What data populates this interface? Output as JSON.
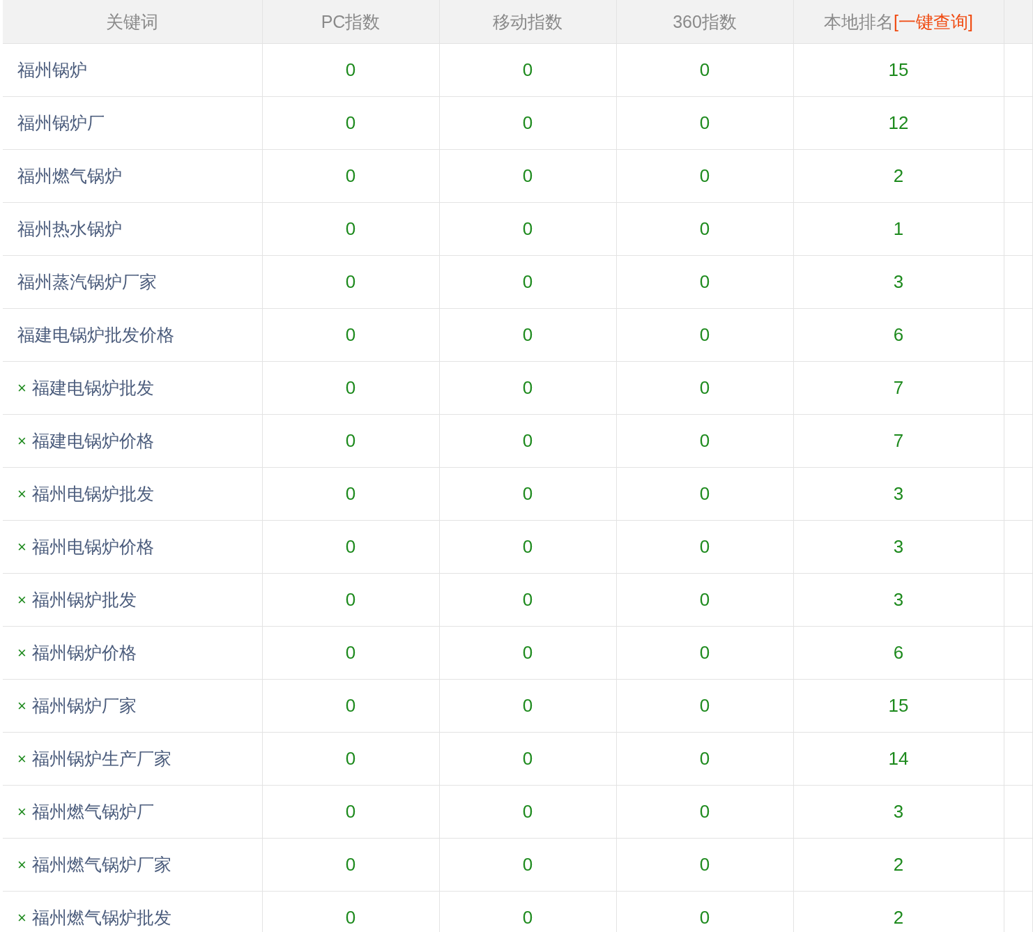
{
  "table": {
    "columns": [
      {
        "label": "关键词"
      },
      {
        "label": "PC指数"
      },
      {
        "label": "移动指数"
      },
      {
        "label": "360指数"
      },
      {
        "label": "本地排名",
        "link": "[一键查询]"
      }
    ],
    "rows": [
      {
        "prefix": null,
        "keyword": "福州锅炉",
        "pc": "0",
        "mobile": "0",
        "idx360": "0",
        "rank": "15"
      },
      {
        "prefix": null,
        "keyword": "福州锅炉厂",
        "pc": "0",
        "mobile": "0",
        "idx360": "0",
        "rank": "12"
      },
      {
        "prefix": null,
        "keyword": "福州燃气锅炉",
        "pc": "0",
        "mobile": "0",
        "idx360": "0",
        "rank": "2"
      },
      {
        "prefix": null,
        "keyword": "福州热水锅炉",
        "pc": "0",
        "mobile": "0",
        "idx360": "0",
        "rank": "1"
      },
      {
        "prefix": null,
        "keyword": "福州蒸汽锅炉厂家",
        "pc": "0",
        "mobile": "0",
        "idx360": "0",
        "rank": "3"
      },
      {
        "prefix": null,
        "keyword": "福建电锅炉批发价格",
        "pc": "0",
        "mobile": "0",
        "idx360": "0",
        "rank": "6"
      },
      {
        "prefix": "×",
        "keyword": "福建电锅炉批发",
        "pc": "0",
        "mobile": "0",
        "idx360": "0",
        "rank": "7"
      },
      {
        "prefix": "×",
        "keyword": "福建电锅炉价格",
        "pc": "0",
        "mobile": "0",
        "idx360": "0",
        "rank": "7"
      },
      {
        "prefix": "×",
        "keyword": "福州电锅炉批发",
        "pc": "0",
        "mobile": "0",
        "idx360": "0",
        "rank": "3"
      },
      {
        "prefix": "×",
        "keyword": "福州电锅炉价格",
        "pc": "0",
        "mobile": "0",
        "idx360": "0",
        "rank": "3"
      },
      {
        "prefix": "×",
        "keyword": "福州锅炉批发",
        "pc": "0",
        "mobile": "0",
        "idx360": "0",
        "rank": "3"
      },
      {
        "prefix": "×",
        "keyword": "福州锅炉价格",
        "pc": "0",
        "mobile": "0",
        "idx360": "0",
        "rank": "6"
      },
      {
        "prefix": "×",
        "keyword": "福州锅炉厂家",
        "pc": "0",
        "mobile": "0",
        "idx360": "0",
        "rank": "15"
      },
      {
        "prefix": "×",
        "keyword": "福州锅炉生产厂家",
        "pc": "0",
        "mobile": "0",
        "idx360": "0",
        "rank": "14"
      },
      {
        "prefix": "×",
        "keyword": "福州燃气锅炉厂",
        "pc": "0",
        "mobile": "0",
        "idx360": "0",
        "rank": "3"
      },
      {
        "prefix": "×",
        "keyword": "福州燃气锅炉厂家",
        "pc": "0",
        "mobile": "0",
        "idx360": "0",
        "rank": "2"
      },
      {
        "prefix": "×",
        "keyword": "福州燃气锅炉批发",
        "pc": "0",
        "mobile": "0",
        "idx360": "0",
        "rank": "2"
      }
    ]
  }
}
